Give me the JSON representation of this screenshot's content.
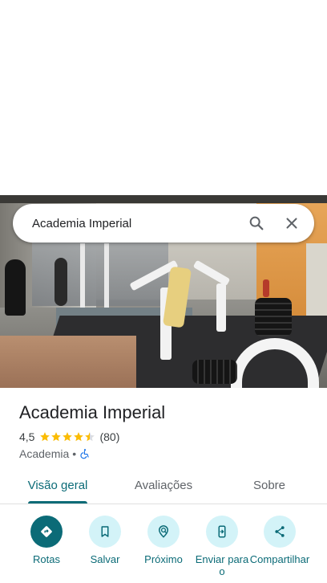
{
  "search": {
    "query": "Academia Imperial",
    "search_icon": "search-icon",
    "clear_icon": "close-icon"
  },
  "hero": {
    "image": "gym-interior-photo"
  },
  "place": {
    "name": "Academia Imperial",
    "rating": "4,5",
    "rating_value": 4.5,
    "stars_max": 5,
    "review_count": "(80)",
    "category": "Academia",
    "separator": "•",
    "accessibility_icon": "wheelchair-icon"
  },
  "tabs": [
    {
      "label": "Visão geral",
      "selected": true
    },
    {
      "label": "Avaliações",
      "selected": false
    },
    {
      "label": "Sobre",
      "selected": false
    }
  ],
  "actions": [
    {
      "label": "Rotas",
      "icon": "directions-icon"
    },
    {
      "label": "Salvar",
      "icon": "bookmark-icon"
    },
    {
      "label": "Próximo",
      "icon": "nearby-icon"
    },
    {
      "label": "Enviar para o",
      "icon": "send-to-phone-icon"
    },
    {
      "label": "Compartilhar",
      "icon": "share-icon"
    }
  ],
  "colors": {
    "accent": "#0b6b77",
    "action_bg": "#d3f3f8",
    "star": "#fbbc04",
    "accessibility": "#1a73e8"
  }
}
